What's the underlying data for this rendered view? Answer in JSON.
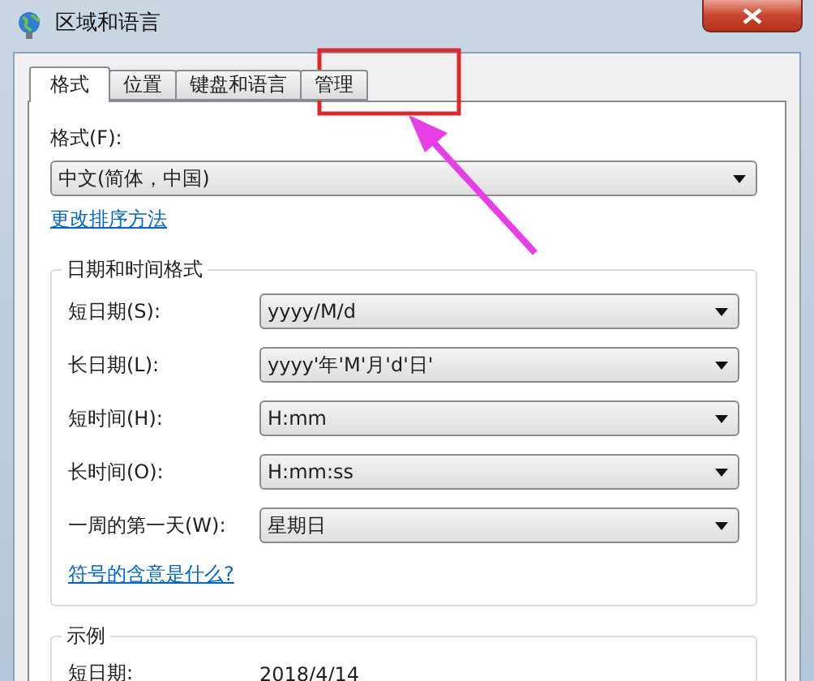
{
  "window": {
    "title": "区域和语言"
  },
  "tabs": [
    {
      "label": "格式",
      "selected": true
    },
    {
      "label": "位置",
      "selected": false
    },
    {
      "label": "键盘和语言",
      "selected": false
    },
    {
      "label": "管理",
      "selected": false
    }
  ],
  "format": {
    "label": "格式(F):",
    "value": "中文(简体，中国)"
  },
  "sort_link": "更改排序方法",
  "date_time_group": {
    "title": "日期和时间格式",
    "rows": [
      {
        "label": "短日期(S):",
        "value": "yyyy/M/d"
      },
      {
        "label": "长日期(L):",
        "value": "yyyy'年'M'月'd'日'"
      },
      {
        "label": "短时间(H):",
        "value": "H:mm"
      },
      {
        "label": "长时间(O):",
        "value": "H:mm:ss"
      },
      {
        "label": "一周的第一天(W):",
        "value": "星期日"
      }
    ],
    "link": "符号的含意是什么?"
  },
  "example_group": {
    "title": "示例",
    "rows": [
      {
        "label": "短日期:",
        "value": "2018/4/14"
      }
    ]
  }
}
